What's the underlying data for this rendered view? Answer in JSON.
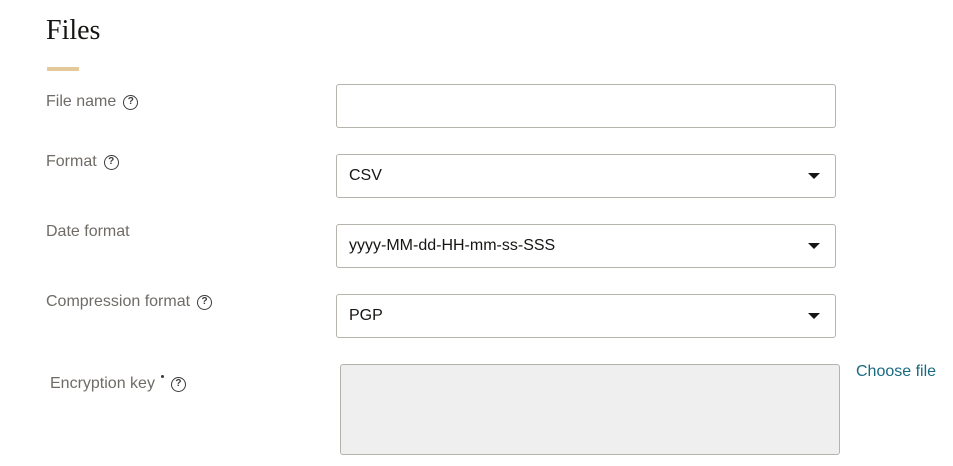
{
  "section": {
    "title": "Files"
  },
  "fields": {
    "file_name": {
      "label": "File name",
      "value": ""
    },
    "format": {
      "label": "Format",
      "selected": "CSV"
    },
    "date_format": {
      "label": "Date format",
      "selected": "yyyy-MM-dd-HH-mm-ss-SSS"
    },
    "compression_format": {
      "label": "Compression format",
      "selected": "PGP"
    },
    "encryption_key": {
      "label": "Encryption key",
      "value": "",
      "choose_file_label": "Choose file"
    }
  },
  "icons": {
    "help": "?"
  },
  "colors": {
    "accent_underline": "#e4c999",
    "link": "#1a6a82",
    "disabled_bg": "#efefef"
  }
}
